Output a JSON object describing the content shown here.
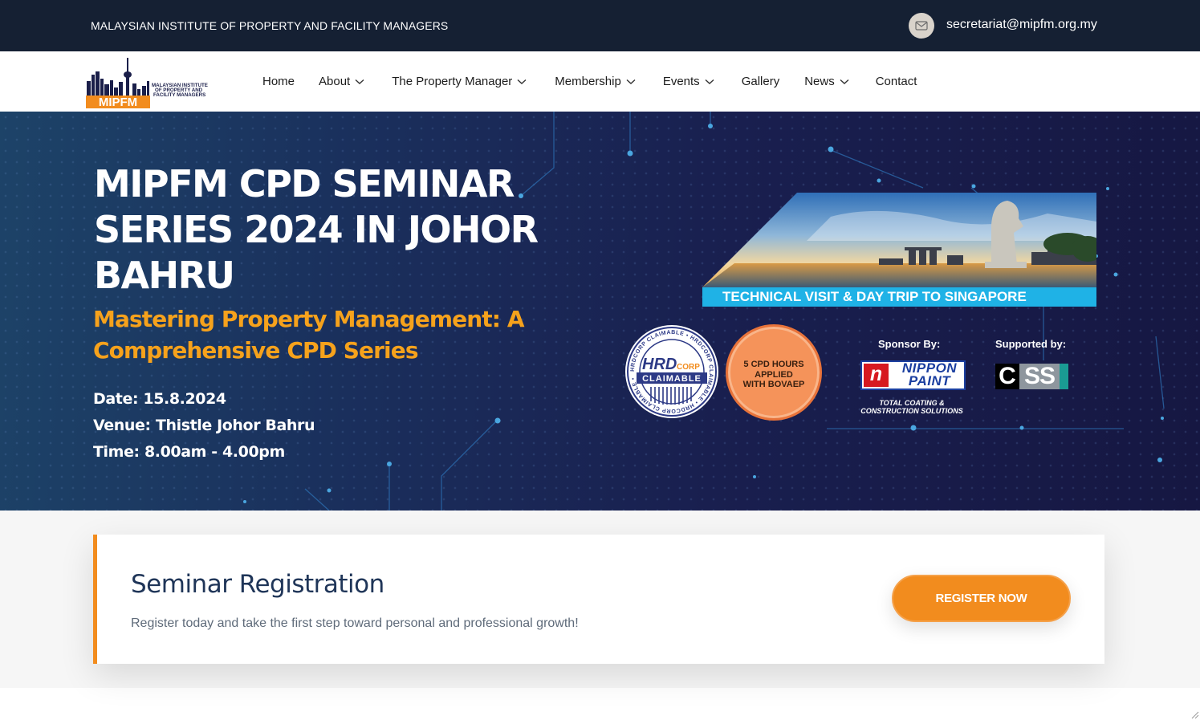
{
  "topbar": {
    "org_name": "MALAYSIAN INSTITUTE OF PROPERTY AND FACILITY MANAGERS",
    "email": "secretariat@mipfm.org.my",
    "email_icon": "envelope-icon"
  },
  "logo": {
    "acronym": "MIPFM",
    "tagline_line1": "MALAYSIAN INSTITUTE",
    "tagline_line2": "OF PROPERTY AND",
    "tagline_line3": "FACILITY MANAGERS"
  },
  "nav": {
    "home": "Home",
    "about": "About",
    "property_manager": "The Property Manager",
    "membership": "Membership",
    "events": "Events",
    "gallery": "Gallery",
    "news": "News",
    "contact": "Contact",
    "dropdown_icon": "chevron-down-icon"
  },
  "hero": {
    "title": "MIPFM CPD SEMINAR SERIES 2024 IN JOHOR BAHRU",
    "subtitle": "Mastering Property Management: A Comprehensive CPD Series",
    "date": "Date: 15.8.2024",
    "venue": "Venue: Thistle Johor Bahru",
    "time": "Time: 8.00am - 4.00pm",
    "promo_caption": "TECHNICAL VISIT & DAY TRIP TO SINGAPORE",
    "hrd_badge": {
      "ring_text": "HRDCORP CLAIMABLE • HRDCORP CLAIMABLE • HRDCORP CLAIMABLE •",
      "brand": "HRD",
      "corp": "CORP",
      "claimable": "CLAIMABLE"
    },
    "cpd_badge": {
      "line1": "5 CPD HOURS",
      "line2": "APPLIED",
      "line3": "WITH BOVAEP"
    },
    "sponsor_label": "Sponsor By:",
    "supporter_label": "Supported by:",
    "sponsor": {
      "mark": "n",
      "line1": "NIPPON",
      "line2": "PAINT",
      "tag_line1": "TOTAL COATING &",
      "tag_line2": "CONSTRUCTION SOLUTIONS"
    },
    "supporter": {
      "letter1": "C",
      "letters": "SS"
    }
  },
  "registration": {
    "heading": "Seminar Registration",
    "description": "Register today and take the first step toward personal and professional growth!",
    "button": "REGISTER NOW"
  },
  "colors": {
    "topbar_bg": "#152033",
    "accent_orange": "#f28c1e",
    "subtitle_orange": "#f6a21c",
    "promo_blue": "#1fb2e6",
    "hero_navy": "#191f4f"
  }
}
